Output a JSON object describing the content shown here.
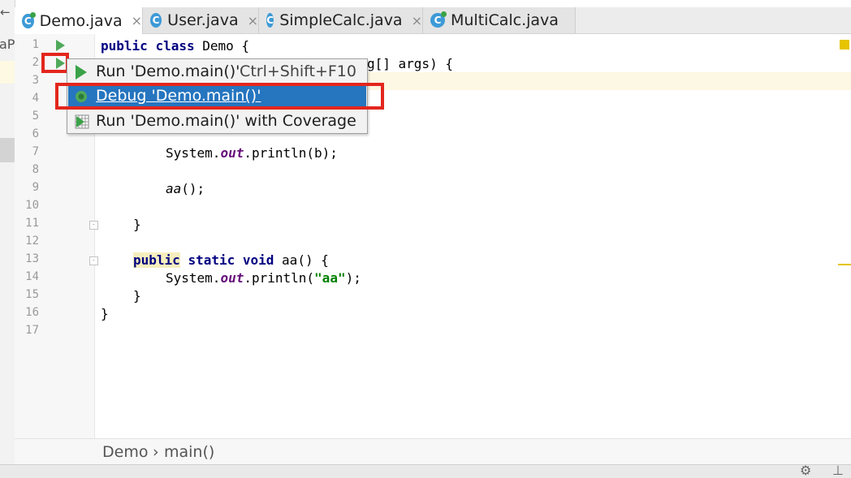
{
  "tabs": [
    {
      "label": "Demo.java",
      "active": true
    },
    {
      "label": "User.java",
      "active": false
    },
    {
      "label": "SimpleCalc.java",
      "active": false
    },
    {
      "label": "MultiCalc.java",
      "active": false
    }
  ],
  "tab_icon_letter": "C",
  "tab_close_glyph": "×",
  "left_panel": {
    "arrow": "←",
    "fragment": "aP"
  },
  "line_numbers": [
    "1",
    "2",
    "3",
    "4",
    "5",
    "6",
    "7",
    "8",
    "9",
    "10",
    "11",
    "12",
    "13",
    "14",
    "15",
    "16",
    "17"
  ],
  "code": {
    "l1_kw1": "public",
    "l1_kw2": "class",
    "l1_rest": "Demo {",
    "l2_tail": "g[] args) {",
    "l7_pre": "System.",
    "l7_field": "out",
    "l7_post": ".println(b);",
    "l9_call": "aa",
    "l9_post": "();",
    "l11": "}",
    "l13_kw1": "public",
    "l13_kw2": "static",
    "l13_kw3": "void",
    "l13_rest": "aa() {",
    "l14_pre": "System.",
    "l14_field": "out",
    "l14_mid": ".println(",
    "l14_str": "\"aa\"",
    "l14_post": ");",
    "l15": "}",
    "l16": "}"
  },
  "context_menu": {
    "items": [
      {
        "label": "Run 'Demo.main()'",
        "shortcut": "Ctrl+Shift+F10",
        "icon": "run-icon",
        "selected": false
      },
      {
        "label": "Debug 'Demo.main()'",
        "shortcut": "",
        "icon": "debug-icon",
        "selected": true
      },
      {
        "label": "Run 'Demo.main()' with Coverage",
        "shortcut": "",
        "icon": "coverage-icon",
        "selected": false
      }
    ]
  },
  "breadcrumb": {
    "class": "Demo",
    "separator": "›",
    "method": "main()"
  },
  "status_icons": {
    "gear": "⚙",
    "pin": "⊥"
  },
  "colors": {
    "keyword": "#000080",
    "field": "#660e7a",
    "string": "#008000",
    "selection": "#2675bf",
    "highlight_box": "#e3261d",
    "run_green": "#4fa95a"
  }
}
